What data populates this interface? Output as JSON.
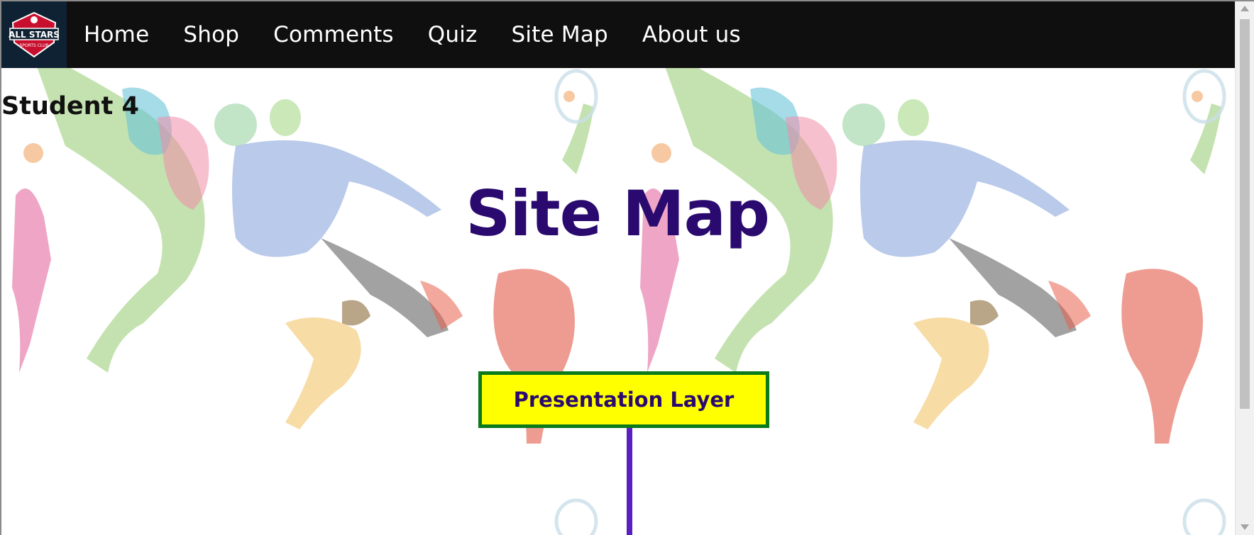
{
  "nav": {
    "logo_icon": "all-stars-sports-club-logo",
    "items": [
      {
        "label": "Home"
      },
      {
        "label": "Shop"
      },
      {
        "label": "Comments"
      },
      {
        "label": "Quiz"
      },
      {
        "label": "Site Map"
      },
      {
        "label": "About us"
      }
    ]
  },
  "content": {
    "student_label": "Student 4",
    "title": "Site Map",
    "layer_label": "Presentation Layer"
  },
  "colors": {
    "nav_bg": "#0f0f0f",
    "title": "#2a0a6e",
    "box_fill": "#ffff00",
    "box_border": "#0a7a1a",
    "connector": "#5a1fc0"
  }
}
